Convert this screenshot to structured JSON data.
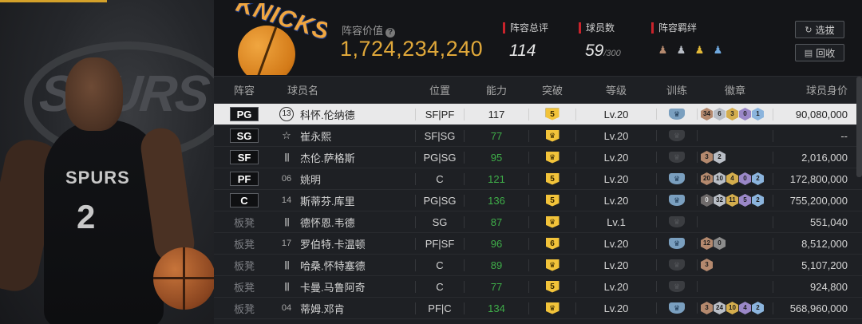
{
  "summary": {
    "value_label": "阵容价值",
    "value": "1,724,234,240",
    "total_label": "阵容总评",
    "total": "114",
    "count_label": "球员数",
    "count": "59",
    "count_max": "/300",
    "bond_label": "阵容羁绊",
    "scout_label": "选拔",
    "recycle_label": "回收",
    "team_logo_text": "KNICKS"
  },
  "hero": {
    "jersey_text": "SPURS",
    "jersey_number": "2",
    "emblem_text": "SPURS"
  },
  "columns": [
    "阵容",
    "球员名",
    "位置",
    "能力",
    "突破",
    "等级",
    "训练",
    "徽章",
    "球员身价"
  ],
  "rows": [
    {
      "slot": "PG",
      "num": "13",
      "num_style": "badge",
      "name": "科怀.伦纳德",
      "position": "SF|PF",
      "ability": "117",
      "ability_color": "white",
      "breakthrough": "5",
      "level": "Lv.20",
      "training": "on",
      "badges": [
        {
          "v": "34",
          "c": "bronze"
        },
        {
          "v": "6",
          "c": "silver"
        },
        {
          "v": "3",
          "c": "gold"
        },
        {
          "v": "0",
          "c": "purple"
        },
        {
          "v": "1",
          "c": "blue"
        }
      ],
      "value": "90,080,000",
      "selected": true
    },
    {
      "slot": "SG",
      "num": "☆",
      "num_style": "star",
      "name": "崔永熙",
      "position": "SF|SG",
      "ability": "77",
      "ability_color": "green",
      "breakthrough": "crown",
      "level": "Lv.20",
      "training": "off",
      "badges": [],
      "value": "--",
      "selected": false
    },
    {
      "slot": "SF",
      "num": "|||",
      "num_style": "bars",
      "name": "杰伦.萨格斯",
      "position": "PG|SG",
      "ability": "95",
      "ability_color": "green",
      "breakthrough": "crown",
      "level": "Lv.20",
      "training": "off",
      "badges": [
        {
          "v": "3",
          "c": "bronze"
        },
        {
          "v": "2",
          "c": "silver"
        }
      ],
      "value": "2,016,000",
      "selected": false
    },
    {
      "slot": "PF",
      "num": "06",
      "num_style": "plain",
      "name": "姚明",
      "position": "C",
      "ability": "121",
      "ability_color": "green",
      "breakthrough": "5",
      "level": "Lv.20",
      "training": "on",
      "badges": [
        {
          "v": "20",
          "c": "bronze"
        },
        {
          "v": "10",
          "c": "silver"
        },
        {
          "v": "4",
          "c": "gold"
        },
        {
          "v": "0",
          "c": "purple"
        },
        {
          "v": "2",
          "c": "blue"
        }
      ],
      "value": "172,800,000",
      "selected": false
    },
    {
      "slot": "C",
      "num": "14",
      "num_style": "plain",
      "name": "斯蒂芬.库里",
      "position": "PG|SG",
      "ability": "136",
      "ability_color": "green",
      "breakthrough": "5",
      "level": "Lv.20",
      "training": "on",
      "badges": [
        {
          "v": "0",
          "c": "dark"
        },
        {
          "v": "32",
          "c": "silver"
        },
        {
          "v": "11",
          "c": "gold"
        },
        {
          "v": "5",
          "c": "purple"
        },
        {
          "v": "2",
          "c": "blue"
        }
      ],
      "value": "755,200,000",
      "selected": false
    },
    {
      "slot": "板凳",
      "num": "|||",
      "num_style": "bars",
      "name": "德怀恩.韦德",
      "position": "SG",
      "ability": "87",
      "ability_color": "green",
      "breakthrough": "crown",
      "level": "Lv.1",
      "training": "off",
      "badges": [],
      "value": "551,040",
      "selected": false
    },
    {
      "slot": "板凳",
      "num": "17",
      "num_style": "plain",
      "name": "罗伯特.卡温顿",
      "position": "PF|SF",
      "ability": "96",
      "ability_color": "green",
      "breakthrough": "6",
      "level": "Lv.20",
      "training": "on",
      "badges": [
        {
          "v": "12",
          "c": "bronze"
        },
        {
          "v": "0",
          "c": "grey"
        }
      ],
      "value": "8,512,000",
      "selected": false
    },
    {
      "slot": "板凳",
      "num": "|||",
      "num_style": "bars",
      "name": "哈桑.怀特塞德",
      "position": "C",
      "ability": "89",
      "ability_color": "green",
      "breakthrough": "crown",
      "level": "Lv.20",
      "training": "off",
      "badges": [
        {
          "v": "3",
          "c": "bronze"
        }
      ],
      "value": "5,107,200",
      "selected": false
    },
    {
      "slot": "板凳",
      "num": "|||",
      "num_style": "bars",
      "name": "卡曼.马鲁阿奇",
      "position": "C",
      "ability": "77",
      "ability_color": "green",
      "breakthrough": "5",
      "level": "Lv.20",
      "training": "off",
      "badges": [],
      "value": "924,800",
      "selected": false
    },
    {
      "slot": "板凳",
      "num": "04",
      "num_style": "plain",
      "name": "蒂姆.邓肯",
      "position": "PF|C",
      "ability": "134",
      "ability_color": "green",
      "breakthrough": "crown",
      "level": "Lv.20",
      "training": "on",
      "badges": [
        {
          "v": "3",
          "c": "bronze"
        },
        {
          "v": "24",
          "c": "silver"
        },
        {
          "v": "10",
          "c": "gold"
        },
        {
          "v": "4",
          "c": "purple"
        },
        {
          "v": "2",
          "c": "blue"
        }
      ],
      "value": "568,960,000",
      "selected": false
    }
  ]
}
